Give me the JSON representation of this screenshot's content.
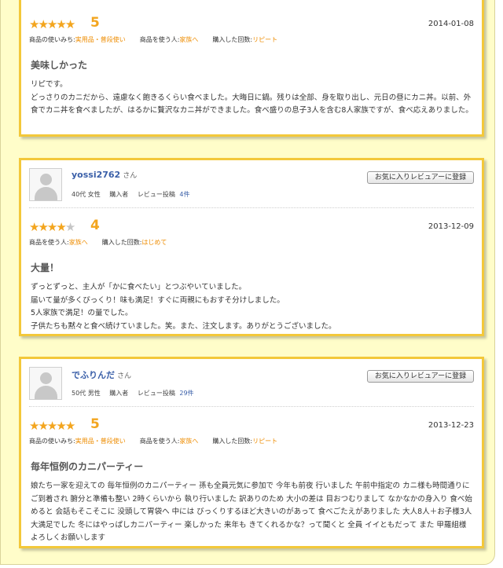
{
  "card_scheme": {
    "border_color": "#f3c83a",
    "star_color": "#f3a51e",
    "tag_value_color": "#ee8c00",
    "link_color": "#3a5fa8"
  },
  "reviews": [
    {
      "score": "5",
      "stars": {
        "filled": 5,
        "empty": 0
      },
      "date": "2014-01-08",
      "tags": [
        {
          "label": "商品の使いみち:",
          "value": "実用品・普段使い"
        },
        {
          "label": "商品を使う人:",
          "value": "家族へ"
        },
        {
          "label": "購入した回数:",
          "value": "リピート"
        }
      ],
      "title": "美味しかった",
      "body": "リピです。\nどっさりのカニだから、遠慮なく飽きるくらい食べました。大晦日に鍋。残りは全部、身を取り出し、元日の昼にカニ丼。以前、外食でカニ丼を食べましたが、はるかに贅沢なカニ丼ができました。食べ盛りの息子3人を含む8人家族ですが、食べ応えありました。"
    },
    {
      "reviewer": {
        "name": "yossi2762",
        "honorific": "さん",
        "age_gender": "40代 女性",
        "buyer": "購入者",
        "posts_label": "レビュー投稿",
        "posts_count": "4件"
      },
      "fav_button": "お気に入りレビュアーに登録",
      "score": "4",
      "stars": {
        "filled": 4,
        "empty": 1
      },
      "date": "2013-12-09",
      "tags": [
        {
          "label": "商品を使う人:",
          "value": "家族へ"
        },
        {
          "label": "購入した回数:",
          "value": "はじめて"
        }
      ],
      "title": "大量！",
      "body": "ずっとずっと、主人が「かに食べたい」とつぶやいていました。\n届いて量が多くびっくり！味も満足！すぐに両親にもおすそ分けしました。\n5人家族で満足！の量でした。\n子供たちも黙々と食べ続けていました。笑。また、注文します。ありがとうございました。"
    },
    {
      "reviewer": {
        "name": "でふりんだ",
        "honorific": "さん",
        "age_gender": "50代 男性",
        "buyer": "購入者",
        "posts_label": "レビュー投稿",
        "posts_count": "29件"
      },
      "fav_button": "お気に入りレビュアーに登録",
      "score": "5",
      "stars": {
        "filled": 5,
        "empty": 0
      },
      "date": "2013-12-23",
      "tags": [
        {
          "label": "商品の使いみち:",
          "value": "実用品・普段使い"
        },
        {
          "label": "商品を使う人:",
          "value": "家族へ"
        },
        {
          "label": "購入した回数:",
          "value": "リピート"
        }
      ],
      "title": "毎年恒例のカニパーティー",
      "body": "娘たち一家を迎えての 毎年恒例のカニパーティー 孫も全員元気に参加で 今年も前夜 行いました 午前中指定の カニ様も時間通りにご到着され 腑分と準備も整い 2時くらいから 執り行いました 訳ありのため 大小の差は 目おつむりまして なかなかの身入り 食べ始めると 会話もそこそこに 没頭して胃袋へ 中には びっくりするほど大きいのがあって 食べごたえがありました 大人8人＋お子様3人 大満足でした 冬にはやっぱしカニパーティー 楽しかった 来年も きてくれるかな？って聞くと 全員 イイともだって また 甲羅組様 よろしくお願いします"
    }
  ]
}
